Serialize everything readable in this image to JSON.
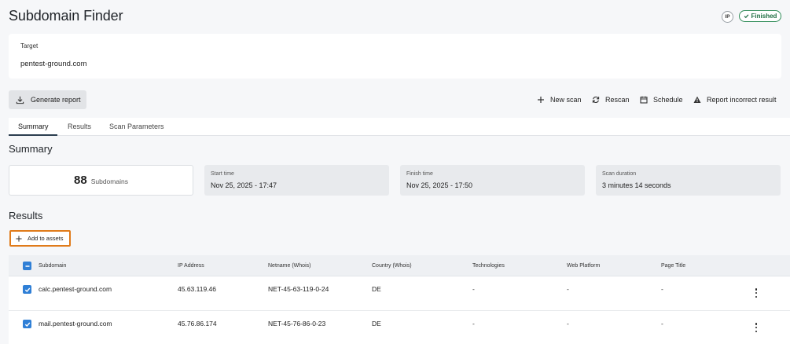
{
  "page": {
    "title": "Subdomain Finder",
    "ip_badge": "IP",
    "status": "Finished"
  },
  "target": {
    "label": "Target",
    "value": "pentest-ground.com"
  },
  "toolbar": {
    "generate_report": "Generate report",
    "new_scan": "New scan",
    "rescan": "Rescan",
    "schedule": "Schedule",
    "report_incorrect": "Report incorrect result"
  },
  "tabs": [
    {
      "label": "Summary",
      "active": true
    },
    {
      "label": "Results",
      "active": false
    },
    {
      "label": "Scan Parameters",
      "active": false
    }
  ],
  "summary": {
    "title": "Summary",
    "subdomain_count": "88",
    "subdomain_label": "Subdomains",
    "start_time_label": "Start time",
    "start_time": "Nov 25, 2025 - 17:47",
    "finish_time_label": "Finish time",
    "finish_time": "Nov 25, 2025 - 17:50",
    "duration_label": "Scan duration",
    "duration": "3 minutes 14 seconds"
  },
  "results": {
    "title": "Results",
    "add_to_assets": "Add to assets",
    "columns": [
      "Subdomain",
      "IP Address",
      "Netname (Whois)",
      "Country (Whois)",
      "Technologies",
      "Web Platform",
      "Page Title"
    ],
    "rows": [
      {
        "subdomain": "calc.pentest-ground.com",
        "ip": "45.63.119.46",
        "netname": "NET-45-63-119-0-24",
        "country": "DE",
        "technologies": "-",
        "web_platform": "-",
        "page_title": "-",
        "checked": true
      },
      {
        "subdomain": "mail.pentest-ground.com",
        "ip": "45.76.86.174",
        "netname": "NET-45-76-86-0-23",
        "country": "DE",
        "technologies": "-",
        "web_platform": "-",
        "page_title": "-",
        "checked": true
      }
    ]
  },
  "colors": {
    "accent_blue": "#2f7fd6",
    "status_green": "#2e8b57",
    "highlight_orange": "#e07b1a"
  },
  "icons": {
    "generate_report": "download-icon",
    "new_scan": "plus-icon",
    "rescan": "refresh-icon",
    "schedule": "calendar-icon",
    "report_incorrect": "warning-icon",
    "status": "check-icon",
    "add_to_assets": "plus-icon",
    "row_menu": "more-vertical-icon"
  }
}
